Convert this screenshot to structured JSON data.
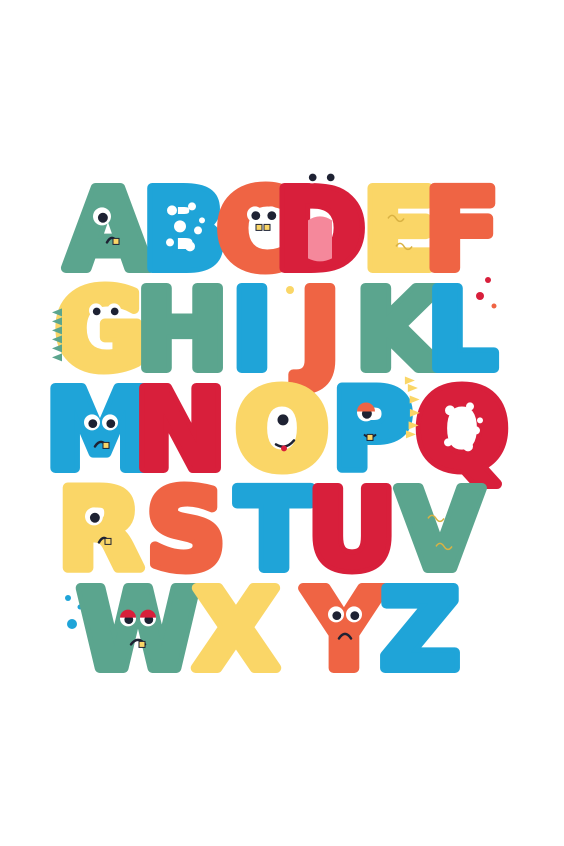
{
  "title": "",
  "colors": {
    "teal": "#5ba58e",
    "blue": "#1fa4d8",
    "yellow": "#fad667",
    "orange": "#ef6444",
    "red": "#d81f3b",
    "pink": "#f5889b",
    "white": "#ffffff",
    "dark": "#1e2233"
  },
  "rows": [
    [
      {
        "char": "A",
        "color": "teal",
        "face": "one-eye"
      },
      {
        "char": "B",
        "color": "blue",
        "pattern": "dots"
      },
      {
        "char": "C",
        "color": "orange",
        "face": "two-eyes-teeth"
      },
      {
        "char": "D",
        "color": "red",
        "face": "tongue-eyes"
      },
      {
        "char": "E",
        "color": "yellow",
        "pattern": "scribbles"
      },
      {
        "char": "F",
        "color": "orange"
      }
    ],
    [
      {
        "char": "G",
        "color": "yellow",
        "face": "spiky-eyes"
      },
      {
        "char": "H",
        "color": "teal"
      },
      {
        "char": "I",
        "color": "blue"
      },
      {
        "char": "J",
        "color": "orange"
      },
      {
        "char": "K",
        "color": "teal"
      },
      {
        "char": "L",
        "color": "blue"
      }
    ],
    [
      {
        "char": "M",
        "color": "blue",
        "face": "two-eyes-tooth"
      },
      {
        "char": "N",
        "color": "red"
      },
      {
        "char": "O",
        "color": "yellow",
        "face": "one-eye-mouth"
      },
      {
        "char": "P",
        "color": "blue",
        "face": "sleepy-spiky"
      },
      {
        "char": "Q",
        "color": "red",
        "pattern": "dots"
      }
    ],
    [
      {
        "char": "R",
        "color": "yellow",
        "face": "one-eye"
      },
      {
        "char": "S",
        "color": "orange"
      },
      {
        "char": "T",
        "color": "blue"
      },
      {
        "char": "U",
        "color": "red"
      },
      {
        "char": "V",
        "color": "teal",
        "pattern": "scribbles"
      }
    ],
    [
      {
        "char": "W",
        "color": "teal",
        "face": "grumpy-eyes"
      },
      {
        "char": "X",
        "color": "yellow"
      },
      {
        "char": "Y",
        "color": "orange",
        "face": "two-eyes-sad"
      },
      {
        "char": "Z",
        "color": "blue"
      }
    ]
  ]
}
